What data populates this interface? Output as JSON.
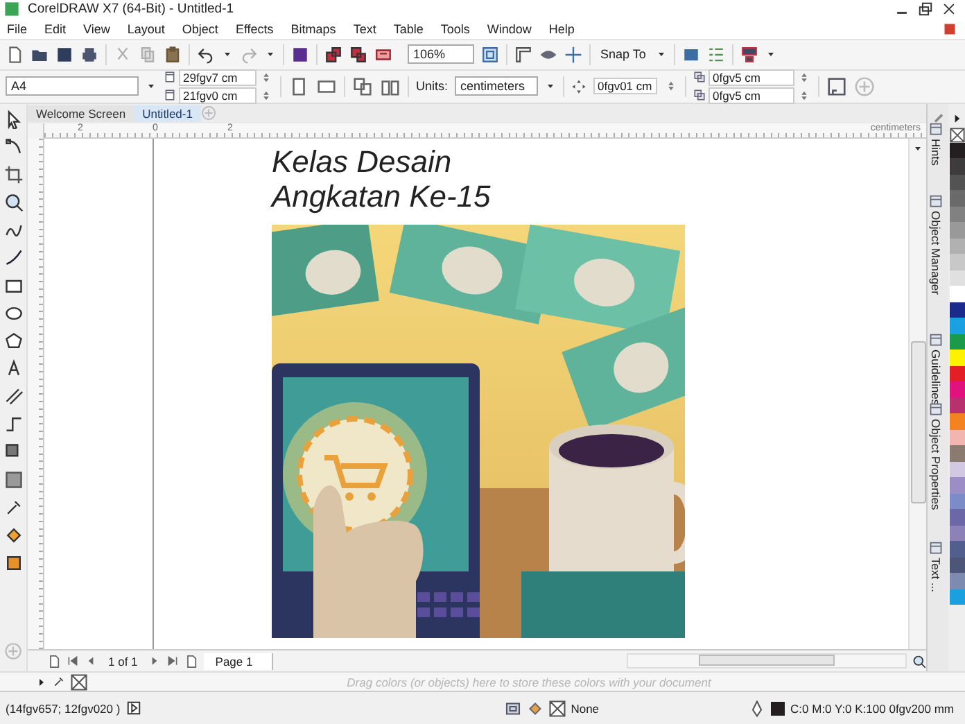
{
  "window": {
    "title": "CorelDRAW X7 (64-Bit) - Untitled-1"
  },
  "menu": [
    "File",
    "Edit",
    "View",
    "Layout",
    "Object",
    "Effects",
    "Bitmaps",
    "Text",
    "Table",
    "Tools",
    "Window",
    "Help"
  ],
  "toolbar": {
    "zoom": "106%",
    "snap": "Snap To"
  },
  "property_bar": {
    "page_size": "A4",
    "width": "29fgv7 cm",
    "height": "21fgv0 cm",
    "units_label": "Units:",
    "units": "centimeters",
    "nudge": "0fgv01 cm",
    "duplicate_x": "0fgv5 cm",
    "duplicate_y": "0fgv5 cm"
  },
  "tabs": [
    {
      "label": "Welcome Screen",
      "selected": false
    },
    {
      "label": "Untitled-1",
      "selected": true
    }
  ],
  "ruler": {
    "unit": "centimeters",
    "labels": [
      "2",
      "0",
      "2"
    ]
  },
  "canvas": {
    "heading": [
      "Kelas Desain",
      "Angkatan Ke-15"
    ]
  },
  "page_nav": {
    "counter": "1 of 1",
    "pages": [
      {
        "label": "Page 1",
        "selected": true
      }
    ]
  },
  "dockers": [
    "Hints",
    "Object Manager",
    "Guidelines",
    "Object Properties",
    "Text ..."
  ],
  "palette": [
    {
      "color": "#231f20"
    },
    {
      "color": "#3d3b3c"
    },
    {
      "color": "#545354"
    },
    {
      "color": "#6b6a6b"
    },
    {
      "color": "#828182"
    },
    {
      "color": "#9a999a"
    },
    {
      "color": "#b2b1b2"
    },
    {
      "color": "#c9c8c9"
    },
    {
      "color": "#e0e0e0"
    },
    {
      "color": "#ffffff"
    },
    {
      "color": "#1c2a8c"
    },
    {
      "color": "#1ba1e2"
    },
    {
      "color": "#1a9a4a"
    },
    {
      "color": "#fff200"
    },
    {
      "color": "#e31e24"
    },
    {
      "color": "#e0137e"
    },
    {
      "color": "#b8306e"
    },
    {
      "color": "#f58220"
    },
    {
      "color": "#f2b5b0"
    },
    {
      "color": "#8a7a70"
    },
    {
      "color": "#d2c8e4"
    },
    {
      "color": "#9c8dc6"
    },
    {
      "color": "#7c8cc8"
    },
    {
      "color": "#6c68a8"
    },
    {
      "color": "#8c82b8"
    },
    {
      "color": "#525e8e"
    },
    {
      "color": "#4d5578"
    },
    {
      "color": "#7d8bb0"
    },
    {
      "color": "#1aa0e0"
    }
  ],
  "document_palette": {
    "hint": "Drag colors (or objects) here to store these colors with your document"
  },
  "status_bar": {
    "coordinates": "(14fgv657; 12fgv020 )",
    "fill": "None",
    "outline": "C:0 M:0 Y:0 K:100  0fgv200 mm"
  }
}
